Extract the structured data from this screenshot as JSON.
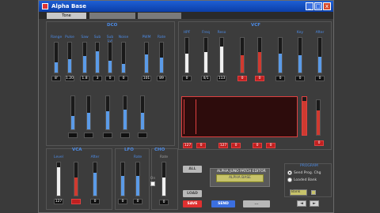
{
  "window": {
    "title": "Alpha Base",
    "minimize": "_",
    "maximize": "□",
    "close": "x"
  },
  "tabs": [
    {
      "label": "Tone"
    },
    {
      "label": ""
    },
    {
      "label": ""
    }
  ],
  "dco": {
    "title": "DCO",
    "labels": [
      "Range",
      "Pulse",
      "Saw",
      "Sub",
      "Sub Lvl",
      "Noise",
      "PWM",
      "Rate"
    ],
    "values": [
      "8'",
      "1.20",
      "1.8",
      "3",
      "0",
      "0",
      "101",
      "89"
    ],
    "levels": [
      0.35,
      0.45,
      0.55,
      0.7,
      0.4,
      0.3,
      0.6,
      0.5
    ],
    "row2": {
      "labels": [
        "",
        "",
        "",
        "",
        ""
      ],
      "values": [
        "",
        "",
        "",
        "",
        ""
      ],
      "levels": [
        0.4,
        0.5,
        0.55,
        0.6,
        0.5
      ]
    }
  },
  "vcf": {
    "title": "VCF",
    "labels": [
      "HPF",
      "Freq",
      "Reso",
      "",
      "",
      "",
      "Key",
      "After"
    ],
    "values": [
      "0",
      "4/1",
      "113",
      "0",
      "0",
      "0",
      "0",
      "0"
    ],
    "levels": [
      0.55,
      0.6,
      0.75,
      0.5,
      0.6,
      0.55,
      0.5,
      0.45
    ],
    "env_values": [
      "127",
      "0",
      "127",
      "0",
      "0",
      "0"
    ],
    "env_levels": [
      0.9,
      0.6,
      0.65,
      0.5,
      0.5,
      0.4
    ],
    "right_value": "0",
    "right_level": 0.9
  },
  "vca": {
    "title": "VCA",
    "labels": [
      "Level",
      "",
      "After"
    ],
    "values": [
      "127",
      "",
      "0"
    ],
    "levels": [
      0.85,
      0.55,
      0.7
    ]
  },
  "lfo": {
    "title": "LFO",
    "labels": [
      "",
      "Rate"
    ],
    "values": [
      "0",
      "0"
    ],
    "levels": [
      0.6,
      0.6
    ]
  },
  "cho": {
    "title": "CHO",
    "labels": [
      "On",
      "Rate"
    ],
    "value": "0",
    "level": 0.55
  },
  "buttons": {
    "all": "ALL",
    "load": "LOAD",
    "save": "SAVE",
    "send": "SEND",
    "more": "..."
  },
  "editor": {
    "title": "ALPHA JUNO PATCH EDITOR",
    "lcd_text": "ALPHA BASE"
  },
  "program": {
    "title": "PROGRAM",
    "options": [
      "Send Prog. Chg",
      "Loaded Bank"
    ],
    "selected_index": 0,
    "select_value": "Bank",
    "prev": "◄",
    "next": "►"
  },
  "colors": {
    "accent_blue": "#4c8be6",
    "accent_red": "#e04040"
  }
}
